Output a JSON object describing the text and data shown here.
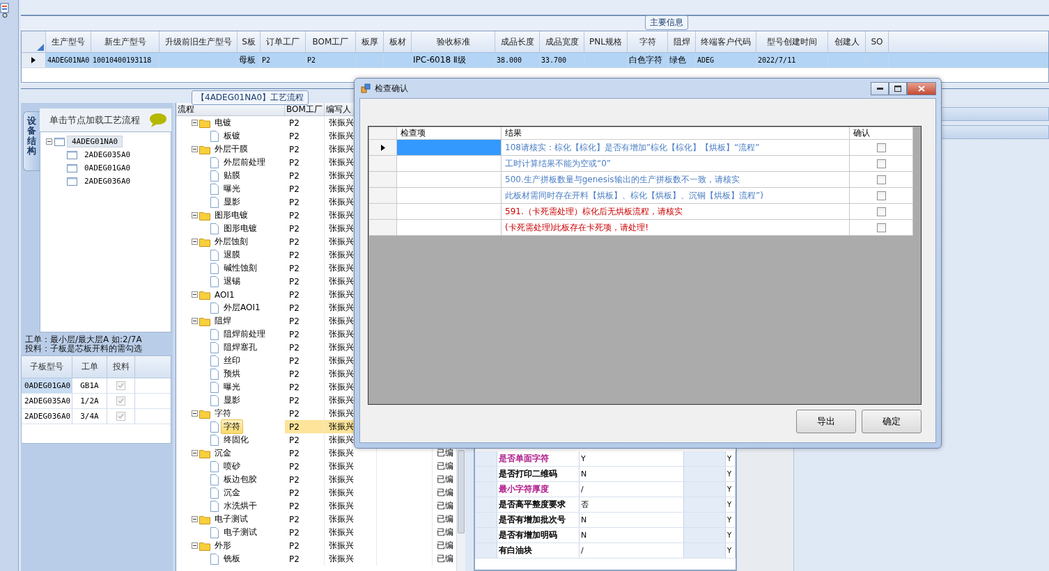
{
  "main_info": {
    "title": "主要信息",
    "columns": [
      "生产型号",
      "新生产型号",
      "升级前旧生产型号",
      "S板",
      "订单工厂",
      "BOM工厂",
      "板厚",
      "板材",
      "验收标准",
      "成品长度",
      "成品宽度",
      "PNL规格",
      "字符",
      "阻焊",
      "终端客户代码",
      "型号创建时间",
      "创建人",
      "SO"
    ],
    "rows": [
      {
        "selected": true,
        "cells": [
          "4ADEG01NA0",
          "10010400193118",
          null,
          "母板",
          "P2",
          "P2",
          null,
          null,
          "IPC-6018 Ⅱ级",
          "38.000",
          "33.700",
          null,
          "白色字符",
          "绿色",
          "ADEG",
          "2022/7/11",
          null,
          null
        ]
      }
    ]
  },
  "flow_panel": {
    "title": "【4ADEG01NA0】工艺流程",
    "side_tab": "设备结构",
    "tree_hint": "单击节点加载工艺流程",
    "board_tree": [
      {
        "label": "4ADEG01NA0",
        "selected": true,
        "expanded": true,
        "children": [
          {
            "label": "2ADEG035A0",
            "selected": false
          },
          {
            "label": "0ADEG01GA0",
            "selected": false
          },
          {
            "label": "2ADEG036A0",
            "selected": false
          }
        ]
      }
    ],
    "notes": [
      "工单：最小层/最大层A 如:2/7A",
      "投料：子板是芯板开料的需勾选"
    ],
    "sub_boards": {
      "columns": [
        "子板型号",
        "工单",
        "投料"
      ],
      "rows": [
        {
          "board": "0ADEG01GA0",
          "order": "GB1A",
          "checked": true,
          "selected": true
        },
        {
          "board": "2ADEG035A0",
          "order": "1/2A",
          "checked": true,
          "selected": false
        },
        {
          "board": "2ADEG036A0",
          "order": "3/4A",
          "checked": true,
          "selected": false
        }
      ]
    }
  },
  "flow_grid": {
    "columns": [
      "流程",
      "BOM工厂",
      "编写人"
    ],
    "rows": [
      {
        "label": "电镀",
        "bom": "P2",
        "writer": "张振兴",
        "expanded": true,
        "selected": false,
        "children": [
          {
            "label": "板镀",
            "bom": "P2",
            "writer": "张振兴",
            "selected": false
          }
        ]
      },
      {
        "label": "外层干膜",
        "bom": "P2",
        "writer": "张振兴",
        "expanded": true,
        "selected": false,
        "children": [
          {
            "label": "外层前处理",
            "bom": "P2",
            "writer": "张振兴",
            "selected": false
          },
          {
            "label": "贴膜",
            "bom": "P2",
            "writer": "张振兴",
            "selected": false
          },
          {
            "label": "曝光",
            "bom": "P2",
            "writer": "张振兴",
            "selected": false
          },
          {
            "label": "显影",
            "bom": "P2",
            "writer": "张振兴",
            "selected": false
          }
        ]
      },
      {
        "label": "图形电镀",
        "bom": "P2",
        "writer": "张振兴",
        "expanded": true,
        "selected": false,
        "children": [
          {
            "label": "图形电镀",
            "bom": "P2",
            "writer": "张振兴",
            "selected": false
          }
        ]
      },
      {
        "label": "外层蚀刻",
        "bom": "P2",
        "writer": "张振兴",
        "expanded": true,
        "selected": false,
        "children": [
          {
            "label": "退膜",
            "bom": "P2",
            "writer": "张振兴",
            "selected": false
          },
          {
            "label": "碱性蚀刻",
            "bom": "P2",
            "writer": "张振兴",
            "selected": false
          },
          {
            "label": "退锡",
            "bom": "P2",
            "writer": "张振兴",
            "selected": false
          }
        ]
      },
      {
        "label": "AOI1",
        "bom": "P2",
        "writer": "张振兴",
        "expanded": true,
        "selected": false,
        "children": [
          {
            "label": "外层AOI1",
            "bom": "P2",
            "writer": "张振兴",
            "selected": false
          }
        ]
      },
      {
        "label": "阻焊",
        "bom": "P2",
        "writer": "张振兴",
        "expanded": true,
        "selected": false,
        "children": [
          {
            "label": "阻焊前处理",
            "bom": "P2",
            "writer": "张振兴",
            "selected": false
          },
          {
            "label": "阻焊塞孔",
            "bom": "P2",
            "writer": "张振兴",
            "selected": false
          },
          {
            "label": "丝印",
            "bom": "P2",
            "writer": "张振兴",
            "selected": false
          },
          {
            "label": "预烘",
            "bom": "P2",
            "writer": "张振兴",
            "selected": false
          },
          {
            "label": "曝光",
            "bom": "P2",
            "writer": "张振兴",
            "selected": false
          },
          {
            "label": "显影",
            "bom": "P2",
            "writer": "张振兴",
            "selected": false
          }
        ]
      },
      {
        "label": "字符",
        "bom": "P2",
        "writer": "张振兴",
        "expanded": true,
        "selected": false,
        "children": [
          {
            "label": "字符",
            "bom": "P2",
            "writer": "张振兴",
            "selected": true
          },
          {
            "label": "终固化",
            "bom": "P2",
            "writer": "张振兴",
            "selected": false
          }
        ]
      },
      {
        "label": "沉金",
        "bom": "P2",
        "writer": "张振兴",
        "status": "已编",
        "expanded": true,
        "selected": false,
        "children": [
          {
            "label": "喷砂",
            "bom": "P2",
            "writer": "张振兴",
            "status": "已编",
            "selected": false
          },
          {
            "label": "板边包胶",
            "bom": "P2",
            "writer": "张振兴",
            "status": "已编",
            "selected": false
          },
          {
            "label": "沉金",
            "bom": "P2",
            "writer": "张振兴",
            "status": "已编",
            "selected": false
          },
          {
            "label": "水洗烘干",
            "bom": "P2",
            "writer": "张振兴",
            "status": "已编",
            "selected": false
          }
        ]
      },
      {
        "label": "电子测试",
        "bom": "P2",
        "writer": "张振兴",
        "status": "已编",
        "expanded": true,
        "selected": false,
        "children": [
          {
            "label": "电子测试",
            "bom": "P2",
            "writer": "张振兴",
            "status": "已编",
            "selected": false
          }
        ]
      },
      {
        "label": "外形",
        "bom": "P2",
        "writer": "张振兴",
        "status": "已编",
        "expanded": true,
        "selected": false,
        "children": [
          {
            "label": "铣板",
            "bom": "P2",
            "writer": "张振兴",
            "status": "已编",
            "selected": false
          }
        ]
      }
    ]
  },
  "properties": [
    {
      "name": "是否单面字符",
      "value": "Y",
      "flag": "Y",
      "color": "#b0208f"
    },
    {
      "name": "是否打印二维码",
      "value": "N",
      "flag": "Y",
      "color": "#000000"
    },
    {
      "name": "最小字符厚度",
      "value": "/",
      "flag": "Y",
      "color": "#b0208f"
    },
    {
      "name": "是否高平整度要求",
      "value": "否",
      "flag": "Y",
      "color": "#000000"
    },
    {
      "name": "是否有增加批次号",
      "value": "N",
      "flag": "Y",
      "color": "#000000"
    },
    {
      "name": "是否有增加明码",
      "value": "N",
      "flag": "Y",
      "color": "#000000"
    },
    {
      "name": "有白油块",
      "value": "/",
      "flag": "Y",
      "color": "#000000"
    }
  ],
  "dialog": {
    "title": "检查确认",
    "columns": [
      "检查项",
      "结果",
      "确认"
    ],
    "rows": [
      {
        "result": "108请核实：棕化【棕化】是否有增加”棕化【棕化】【烘板】“流程”",
        "color": "#4a7ec4",
        "confirmed": false,
        "selected": true
      },
      {
        "result": "工时计算结果不能为空或“0”",
        "color": "#4a7ec4",
        "confirmed": false,
        "selected": false
      },
      {
        "result": "500.生产拼板数量与genesis输出的生产拼板数不一致，请核实",
        "color": "#4a7ec4",
        "confirmed": false,
        "selected": false
      },
      {
        "result": "此板材需同时存在开料【烘板】、棕化【烘板】、沉铜【烘板】流程”)",
        "color": "#4a7ec4",
        "confirmed": false,
        "selected": false
      },
      {
        "result": "591.（卡死需处理）棕化后无烘板流程，请核实",
        "color": "#cc0000",
        "confirmed": false,
        "selected": false
      },
      {
        "result": "(卡死需处理)此板存在卡死项，请处理!",
        "color": "#cc0000",
        "confirmed": false,
        "selected": false
      }
    ],
    "buttons": [
      "导出",
      "确定"
    ]
  }
}
